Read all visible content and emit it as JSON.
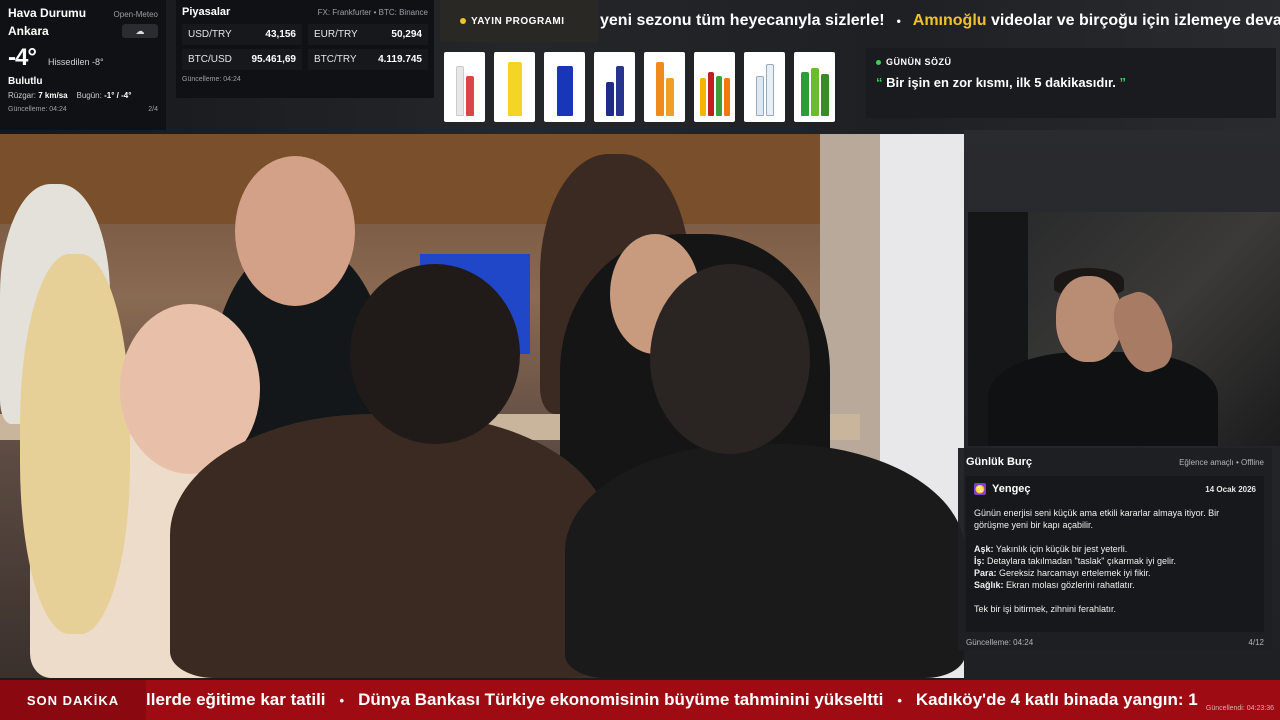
{
  "weather": {
    "title": "Hava Durumu",
    "source": "Open-Meteo",
    "city": "Ankara",
    "temperature": "-4°",
    "feels_like": "Hissedilen -8°",
    "condition": "Bulutlu",
    "wind_label": "Rüzgar:",
    "wind_value": "7 km/sa",
    "today_label": "Bugün:",
    "today_value": "-1° / -4°",
    "updated": "Güncelleme: 04:24",
    "page": "2/4",
    "icon": "cloud-icon"
  },
  "markets": {
    "title": "Piyasalar",
    "source": "FX: Frankfurter • BTC: Binance",
    "items": [
      {
        "symbol": "USD/TRY",
        "value": "43,156"
      },
      {
        "symbol": "EUR/TRY",
        "value": "50,294"
      },
      {
        "symbol": "BTC/USD",
        "value": "95.461,69"
      },
      {
        "symbol": "BTC/TRY",
        "value": "4.119.745"
      }
    ],
    "updated": "Güncelleme: 04:24"
  },
  "program": {
    "label": "YAYIN PROGRAMI"
  },
  "top_ticker": {
    "text1": "yeni sezonu tüm heyecanıyla sizlerle!",
    "separator": "•",
    "highlight": "Amınoğlu",
    "text2": " videolar ve birçoğu için izlemeye devam edin"
  },
  "quote": {
    "label": "GÜNÜN SÖZÜ",
    "text": "Bir işin en zor kısmı, ilk 5 dakikasıdır.",
    "open_mark": "“",
    "close_mark": "”"
  },
  "horoscope": {
    "title": "Günlük Burç",
    "note": "Eğlence amaçlı • Offline",
    "sign": "Yengeç",
    "date": "14 Ocak 2026",
    "intro": "Günün enerjisi seni küçük ama etkili kararlar almaya itiyor. Bir görüşme yeni bir kapı açabilir.",
    "love_label": "Aşk:",
    "love": " Yakınlık için küçük bir jest yeterli.",
    "work_label": "İş:",
    "work": " Detaylara takılmadan \"taslak\" çıkarmak iyi gelir.",
    "money_label": "Para:",
    "money": " Gereksiz harcamayı ertelemek iyi fikir.",
    "health_label": "Sağlık:",
    "health": " Ekran molası gözlerini rahatlatır.",
    "advice": "Tek bir işi bitirmek, zihnini ferahlatır.",
    "updated": "Güncelleme: 04:24",
    "page": "4/12"
  },
  "breaking": {
    "label": "SON DAKİKA",
    "items": [
      "llerde eğitime kar tatili",
      "Dünya Bankası Türkiye ekonomisinin büyüme tahminini yükseltti",
      "Kadıköy'de 4 katlı binada yangın: 1"
    ],
    "separator": "•",
    "updated": "Güncellendi: 04:23:36"
  },
  "colors": {
    "accent_yellow": "#f2c12e",
    "accent_green": "#3ecf5a",
    "breaking_red": "#9e0b12",
    "sign_purple": "#7b3fd1"
  }
}
